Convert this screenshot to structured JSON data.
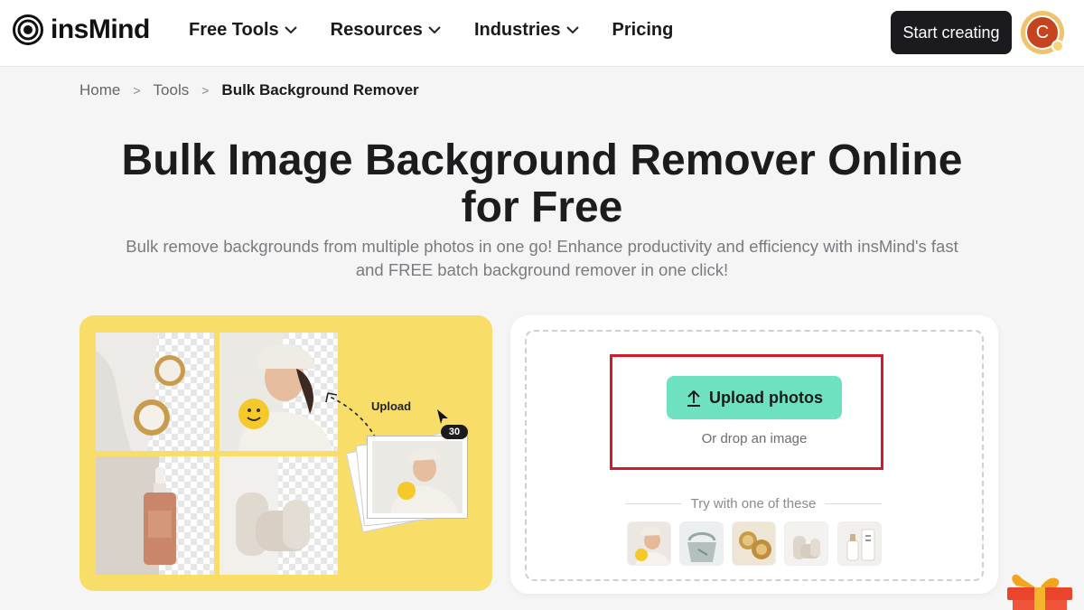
{
  "header": {
    "logo_text": "insMind",
    "nav": [
      {
        "label": "Free Tools",
        "has_dropdown": true
      },
      {
        "label": "Resources",
        "has_dropdown": true
      },
      {
        "label": "Industries",
        "has_dropdown": true
      },
      {
        "label": "Pricing",
        "has_dropdown": false
      }
    ],
    "start_button": "Start creating",
    "avatar_initial": "C"
  },
  "breadcrumb": {
    "home": "Home",
    "tools": "Tools",
    "current": "Bulk Background Remover"
  },
  "hero": {
    "title_line1": "Bulk Image Background Remover Online",
    "title_line2": "for Free",
    "subtitle_line1": "Bulk remove backgrounds from multiple photos in one go! Enhance productivity and efficiency with insMind's fast",
    "subtitle_line2": "and FREE batch background remover in one click!"
  },
  "illustration": {
    "upload_label": "Upload",
    "count_badge": "30"
  },
  "upload": {
    "button_label": "Upload photos",
    "drop_text": "Or drop an image",
    "try_label": "Try with one of these",
    "samples": [
      "woman-with-smiley-ball",
      "green-handbag",
      "gold-earrings",
      "beige-chair",
      "cosmetic-bottles"
    ]
  },
  "colors": {
    "accent_button": "#6ee2c0",
    "panel_yellow": "#f8dd69",
    "highlight_red": "#d11a2a",
    "dark_button": "#1b1b1f"
  }
}
